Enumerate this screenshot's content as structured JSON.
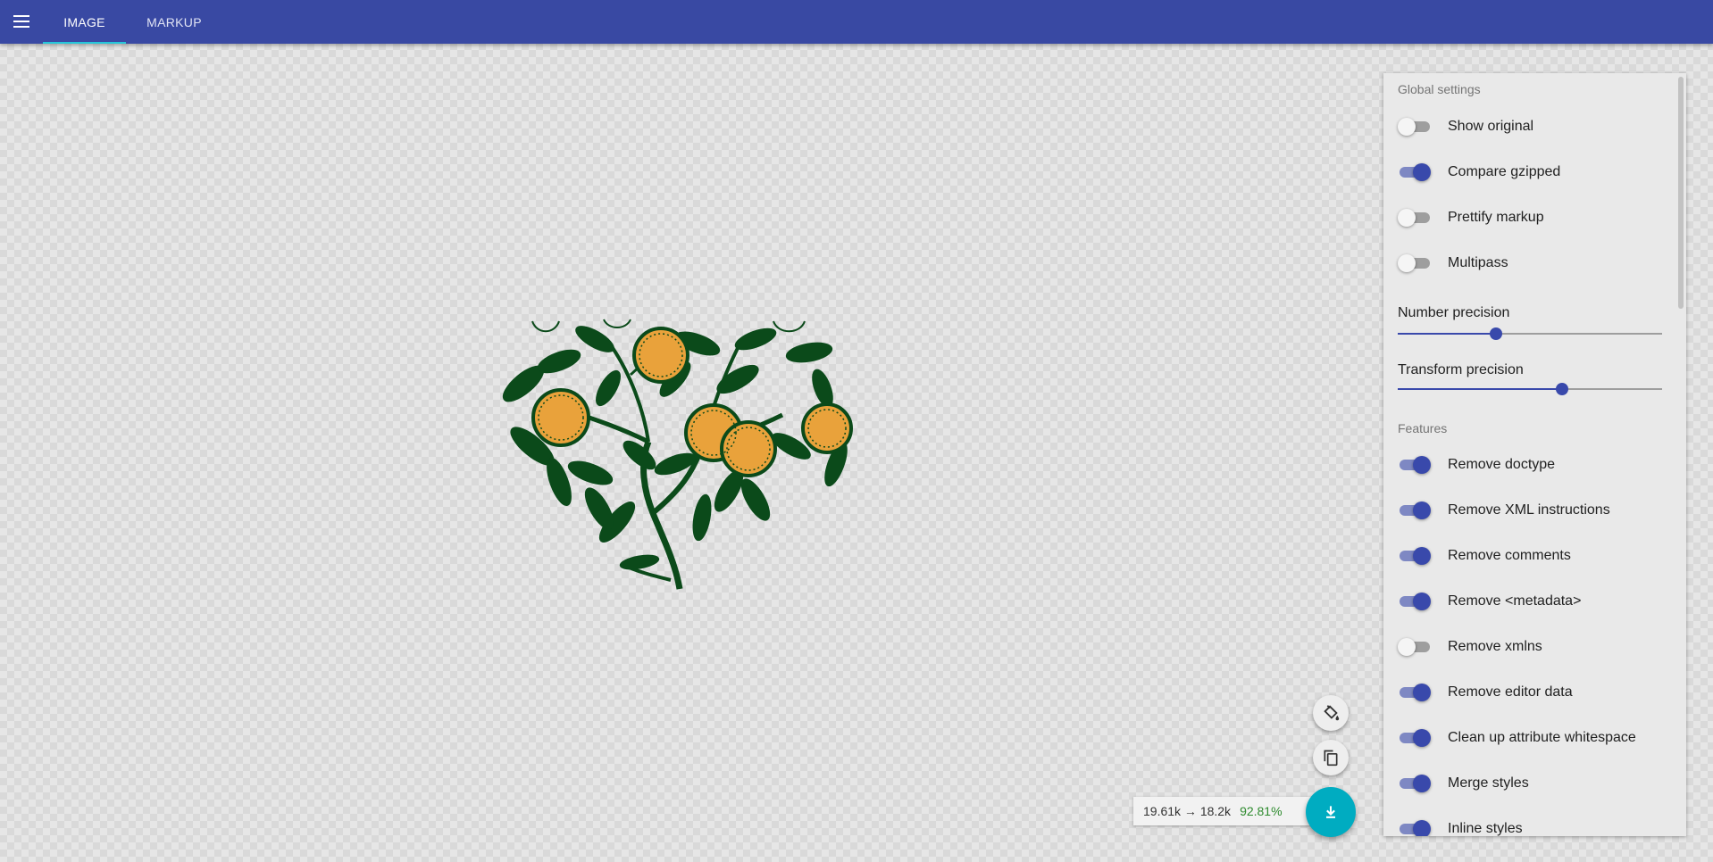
{
  "topbar": {
    "background": "#3949a3",
    "menu_icon": "hamburger-menu-icon",
    "tabs": [
      {
        "label": "IMAGE",
        "active": true
      },
      {
        "label": "MARKUP",
        "active": false
      }
    ],
    "indicator_color": "#26c6da"
  },
  "artwork": {
    "subject": "orange-tree-branch-illustration",
    "leaf_color": "#0b4a1a",
    "fruit_color": "#e9a23b"
  },
  "settings": {
    "global_title": "Global settings",
    "global": [
      {
        "label": "Show original",
        "checked": false
      },
      {
        "label": "Compare gzipped",
        "checked": true
      },
      {
        "label": "Prettify markup",
        "checked": false
      },
      {
        "label": "Multipass",
        "checked": false
      }
    ],
    "sliders": [
      {
        "label": "Number precision",
        "value_fraction": 0.37
      },
      {
        "label": "Transform precision",
        "value_fraction": 0.62
      }
    ],
    "features_title": "Features",
    "features": [
      {
        "label": "Remove doctype",
        "checked": true
      },
      {
        "label": "Remove XML instructions",
        "checked": true
      },
      {
        "label": "Remove comments",
        "checked": true
      },
      {
        "label": "Remove <metadata>",
        "checked": true
      },
      {
        "label": "Remove xmlns",
        "checked": false
      },
      {
        "label": "Remove editor data",
        "checked": true
      },
      {
        "label": "Clean up attribute whitespace",
        "checked": true
      },
      {
        "label": "Merge styles",
        "checked": true
      },
      {
        "label": "Inline styles",
        "checked": true
      }
    ],
    "accent_color": "#3949ab"
  },
  "actions": {
    "background_toggle_icon": "paint-bucket-icon",
    "copy_icon": "copy-icon",
    "download_icon": "download-icon",
    "download_color": "#00acc1",
    "size_text": "19.61k → 18.2k",
    "percent_text": "92.81%"
  }
}
